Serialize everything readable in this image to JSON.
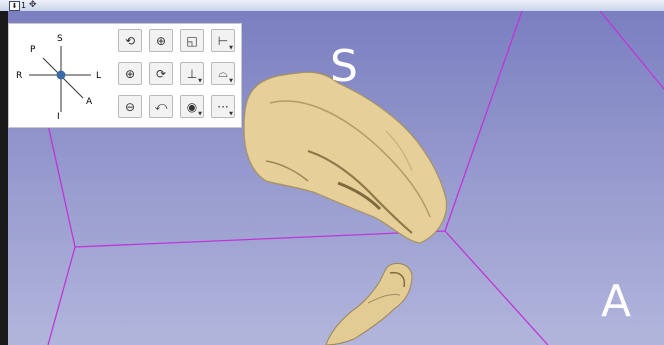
{
  "view": {
    "number": "1",
    "pin_icon": "pin-icon",
    "link_icon": "link-icon",
    "orientation_labels": {
      "top": "S",
      "right": "A"
    }
  },
  "axes_widget": {
    "labels": {
      "s": "S",
      "p": "P",
      "r": "R",
      "l": "L",
      "a": "A",
      "i": "I"
    }
  },
  "toolbar": {
    "buttons": [
      {
        "name": "reset-focal-point-icon",
        "glyph": "⟲"
      },
      {
        "name": "center-view-icon",
        "glyph": "⊕"
      },
      {
        "name": "orthographic-cube-icon",
        "glyph": "◱"
      },
      {
        "name": "ruler-icon",
        "glyph": "⊢"
      },
      {
        "name": "zoom-in-icon",
        "glyph": "⊕"
      },
      {
        "name": "spin-icon",
        "glyph": "⟳"
      },
      {
        "name": "axis-labels-icon",
        "glyph": "⊥"
      },
      {
        "name": "stereo-glasses-icon",
        "glyph": "⌓"
      },
      {
        "name": "zoom-out-icon",
        "glyph": "⊖"
      },
      {
        "name": "rock-icon",
        "glyph": "⤺"
      },
      {
        "name": "eye-icon",
        "glyph": "◉"
      },
      {
        "name": "more-icon",
        "glyph": "···"
      }
    ]
  },
  "colors": {
    "viewport_top": "#7a7fc0",
    "viewport_bottom": "#b2b5db",
    "bounding_box_lines": "#c034d8",
    "model": "#e9d29a"
  }
}
